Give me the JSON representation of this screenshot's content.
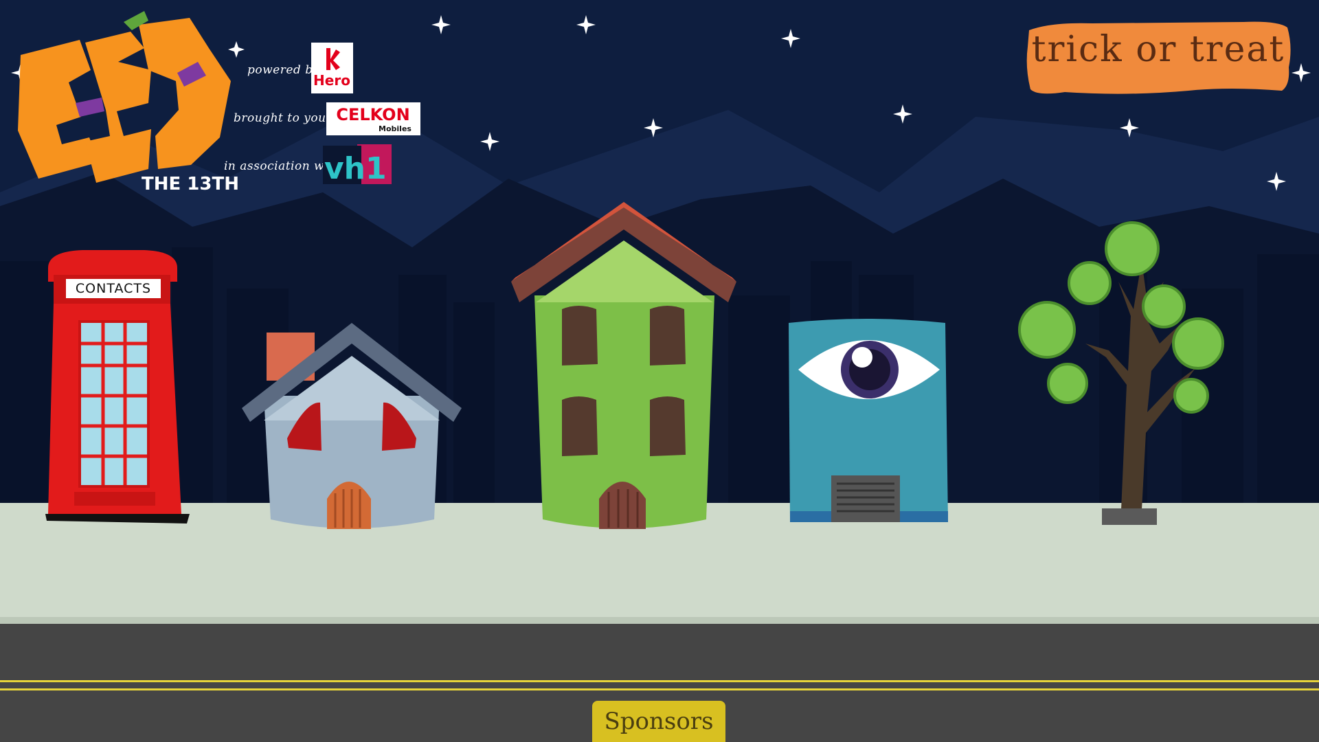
{
  "header": {
    "festival_logo_text": "FESTEMBER",
    "festival_logo_subtitle": "THE 13TH",
    "powered_by_label": "powered by",
    "powered_by_sponsor": "Hero",
    "brought_by_label": "brought to you by",
    "brought_by_sponsor": "CELKON",
    "brought_by_sponsor_sub": "Mobiles",
    "association_label": "in association with",
    "association_sponsor": "vh1"
  },
  "nav": {
    "trick_or_treat_label": "trick or treat",
    "sponsors_label": "Sponsors",
    "contacts_label": "CONTACTS"
  },
  "colors": {
    "sky": "#0e1e3f",
    "ground": "#cfdacb",
    "road": "#454545",
    "road_line": "#e6d33a",
    "trick_button": "#f08a3c",
    "sponsors_button": "#d8c021"
  },
  "icons": [
    "star-icon",
    "phone-booth-icon",
    "blue-house-icon",
    "green-house-icon",
    "eye-building-icon",
    "tree-icon"
  ]
}
